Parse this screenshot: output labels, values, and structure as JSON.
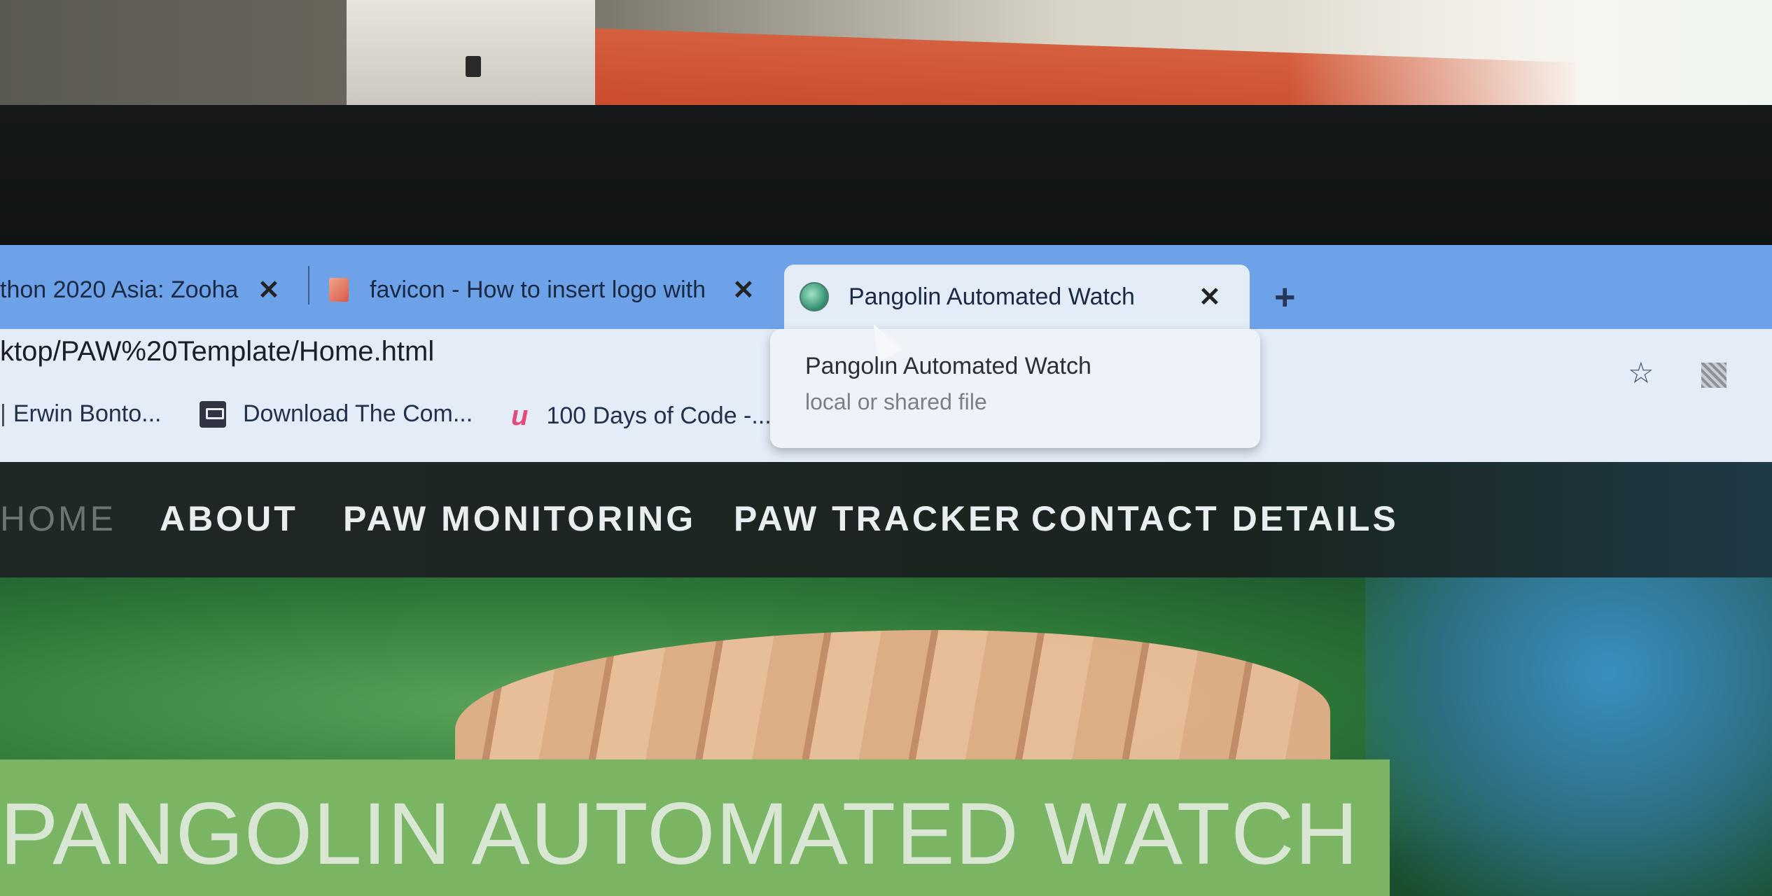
{
  "browser": {
    "tabs": [
      {
        "title": "thon 2020 Asia: Zooha",
        "active": false
      },
      {
        "title": "favicon - How to insert logo with",
        "active": false
      },
      {
        "title": "Pangolin Automated Watch",
        "active": true
      }
    ],
    "new_tab_label": "+",
    "close_label": "✕",
    "address": "ktop/PAW%20Template/Home.html",
    "bookmarks": [
      {
        "label": "Erwin Bonto..."
      },
      {
        "label": "Download The Com..."
      },
      {
        "label": "100 Days of Code -..."
      }
    ],
    "tooltip": {
      "title": "Pangolin Automated Watch",
      "subtitle": "local or shared file"
    },
    "star_icon": "☆",
    "bookmark_u_icon": "u"
  },
  "site": {
    "nav": [
      "HOME",
      "ABOUT",
      "PAW MONITORING",
      "PAW TRACKER",
      "CONTACT DETAILS"
    ],
    "hero_title": "PANGOLIN AUTOMATED WATCH"
  },
  "colors": {
    "tabstrip": "#6ea2e8",
    "nav_bg": "#1f2825",
    "title_band": "#79b563"
  }
}
